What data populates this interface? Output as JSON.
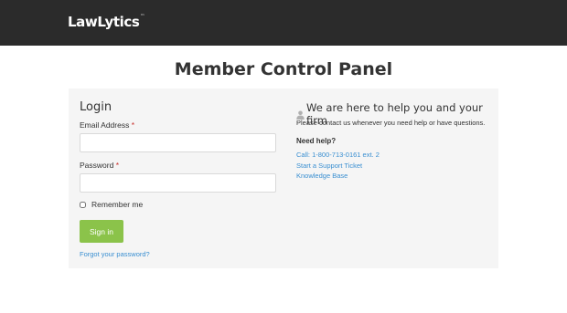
{
  "header": {
    "logo_text": "LawLytics",
    "logo_mark": "™"
  },
  "page": {
    "title": "Member Control Panel"
  },
  "login": {
    "title": "Login",
    "email_label": "Email Address",
    "password_label": "Password",
    "required_mark": "*",
    "email_value": "",
    "password_value": "",
    "remember_label": "Remember me",
    "remember_checked": false,
    "signin_label": "Sign in",
    "forgot_label": "Forgot your password?"
  },
  "help": {
    "title": "We are here to help you and your firm",
    "icon": "user-icon",
    "subtitle": "Please contact us whenever you need help or have questions.",
    "need_help_label": "Need help?",
    "links": [
      "Call: 1-800-713-0161 ext. 2",
      "Start a Support Ticket",
      "Knowledge Base"
    ]
  },
  "colors": {
    "header_bg": "#2b2b2b",
    "panel_bg": "#f5f5f5",
    "button_bg": "#8bc34a",
    "link": "#3a8fd1",
    "required": "#c9302c"
  }
}
